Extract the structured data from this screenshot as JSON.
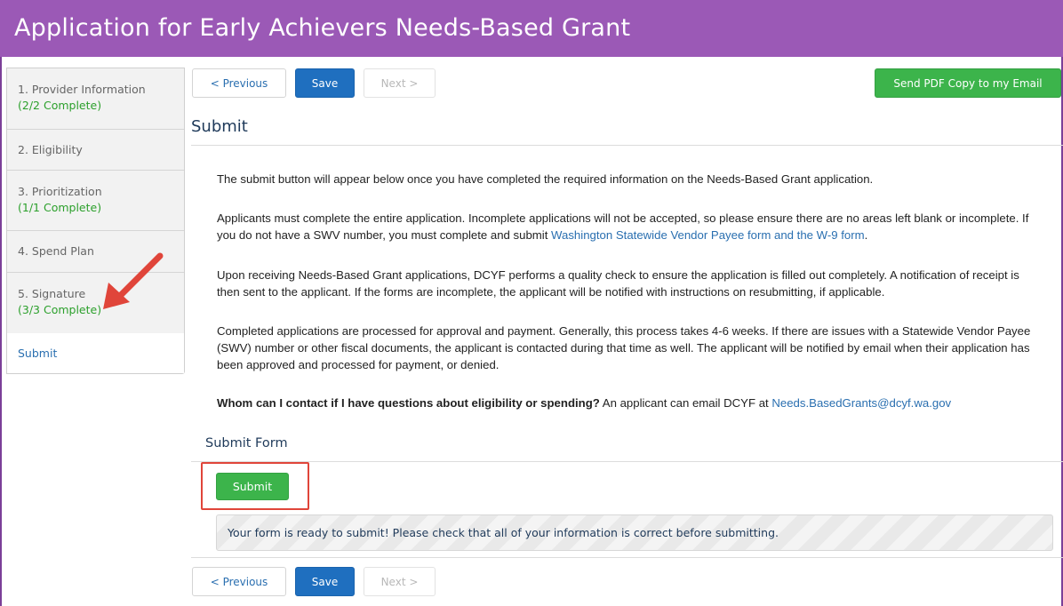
{
  "header": {
    "title": "Application for Early Achievers Needs-Based Grant"
  },
  "sidebar": {
    "items": [
      {
        "label": "1. Provider Information",
        "status": "(2/2 Complete)"
      },
      {
        "label": "2. Eligibility"
      },
      {
        "label": "3. Prioritization",
        "status": "(1/1 Complete)"
      },
      {
        "label": "4. Spend Plan"
      },
      {
        "label": "5. Signature",
        "status": "(3/3 Complete)"
      },
      {
        "label": "Submit"
      }
    ]
  },
  "toolbar": {
    "previous_label": "< Previous",
    "save_label": "Save",
    "next_label": "Next >",
    "email_label": "Send PDF Copy to my Email"
  },
  "main": {
    "heading": "Submit",
    "p1": "The submit button will appear below once you have completed the required information on the Needs-Based Grant application.",
    "p2_text": "Applicants must complete the entire application. Incomplete applications will not be accepted, so please ensure there are no areas left blank or incomplete. If you do not have a SWV number, you must complete and submit ",
    "p2_link": "Washington Statewide Vendor Payee form and the W-9 form",
    "p2_end": ".",
    "p3": "Upon receiving Needs-Based Grant applications, DCYF performs a quality check to ensure the application is filled out completely. A notification of receipt is then sent to the applicant. If the forms are incomplete, the applicant will be notified with instructions on resubmitting, if applicable.",
    "p4": "Completed applications are processed for approval and payment. Generally, this process takes 4-6 weeks. If there are issues with a Statewide Vendor Payee (SWV) number or other fiscal documents, the applicant is contacted during that time as well.  The applicant will be notified by email when their application has been approved and processed for payment, or denied.",
    "p5_bold": "Whom can I contact if I have questions about eligibility or spending?",
    "p5_text": " An applicant can email DCYF at ",
    "p5_link": "Needs.BasedGrants@dcyf.wa.gov",
    "form_heading": "Submit Form",
    "submit_label": "Submit",
    "ready_message": "Your form is ready to submit! Please check that all of your information is correct before submitting."
  },
  "colors": {
    "header_bg": "#9b59b6",
    "complete_green": "#2ca02c",
    "link_blue": "#2a6fb0",
    "save_blue": "#1f6fbf",
    "submit_green": "#3cb44b",
    "annotation_red": "#e0453a"
  }
}
